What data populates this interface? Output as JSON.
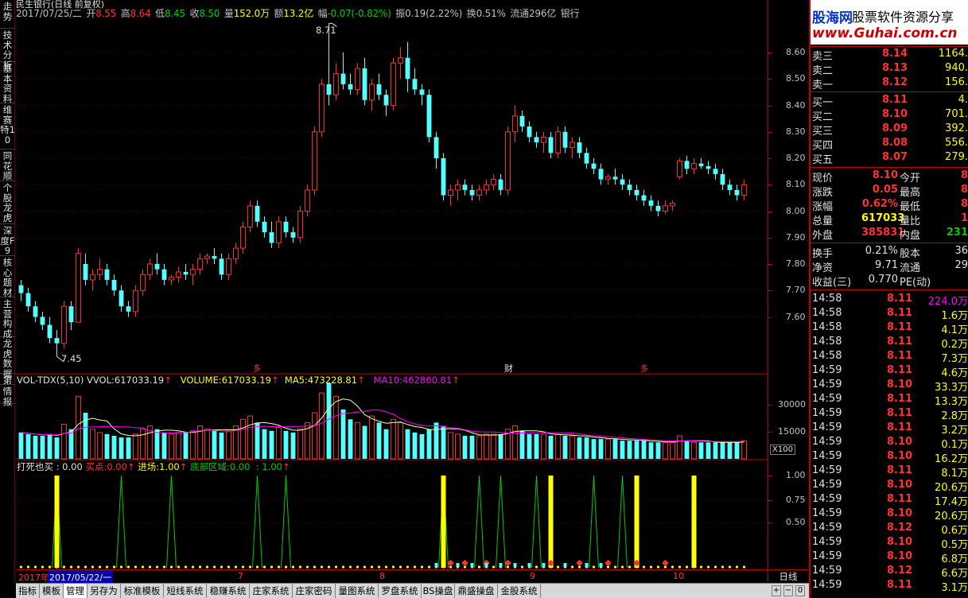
{
  "window": {
    "title": "民生银行(日线 前复权)"
  },
  "info_bar": {
    "date": "2017/07/25/二",
    "open_label": "开",
    "open": "8.55",
    "high_label": "高",
    "high": "8.64",
    "low_label": "低",
    "low": "8.45",
    "close_label": "收",
    "close": "8.50",
    "volume_label": "量",
    "volume": "152.0万",
    "amount_label": "额",
    "amount": "13.2亿",
    "change_label": "幅",
    "change": "-0.07(-0.82%)",
    "amplitude_label": "振",
    "amplitude": "0.19(2.22%)",
    "turnover_label": "换",
    "turnover": "0.51%",
    "float_label": "流通",
    "float": "296亿",
    "industry": "银行"
  },
  "side_tabs": [
    "走势",
    "技术分析",
    "基本资料",
    "维赛特10",
    "同花顺",
    "个股龙虎",
    "深度F9",
    "核心题材",
    "主营构成",
    "龙虎数据",
    "第",
    "情报"
  ],
  "main_chart_annotations": {
    "high_label": "8.71",
    "low_label": "7.45",
    "event_markers": [
      "多",
      "财",
      "多"
    ]
  },
  "price_axis": [
    "8.60",
    "8.50",
    "8.40",
    "8.30",
    "8.20",
    "8.10",
    "8.00",
    "7.90",
    "7.80",
    "7.70",
    "7.60"
  ],
  "volume_panel": {
    "title": "VOL-TDX(5,10)",
    "vvol_label": "VVOL:",
    "vvol": "617033.19",
    "volume_label": "VOLUME:",
    "volume": "617033.19",
    "ma5_label": "MA5:",
    "ma5": "473228.81",
    "ma10_label": "MA10:",
    "ma10": "462860.81",
    "axis": [
      "30000",
      "15000"
    ],
    "unit": "X100"
  },
  "indicator_panel": {
    "name": "打死也买",
    "value": ": 0.00",
    "buy_label": "买点:",
    "buy": "0.00",
    "enter_label": "进场:",
    "enter": "1.00",
    "bottom_label": "底部区域:",
    "bottom": "0.00",
    "extra": ": 1.00",
    "axis": [
      "1.00",
      "0.75",
      "0.50"
    ]
  },
  "date_axis": {
    "start": "2017年",
    "cursor": "2017/05/22/一",
    "months": [
      "7",
      "8",
      "9",
      "10"
    ],
    "period_label": "日线"
  },
  "bottom_tabs": [
    "指标",
    "模板",
    "管理",
    "另存为",
    "标准模板",
    "短线系统",
    "稳赚系统",
    "庄家系统",
    "庄家密码",
    "量图系统",
    "罗盘系统",
    "BS操盘",
    "鼎盛操盘",
    "金股系统"
  ],
  "bottom_tabs_active": "管理",
  "logo": {
    "site_name": "股海网",
    "tagline": "股票软件资源分享",
    "url": "www.Guhai.com.cn"
  },
  "order_book": {
    "asks": [
      {
        "label": "卖三",
        "price": "8.14",
        "vol": "1164."
      },
      {
        "label": "卖二",
        "price": "8.13",
        "vol": "940."
      },
      {
        "label": "卖一",
        "price": "8.12",
        "vol": "156."
      }
    ],
    "bids": [
      {
        "label": "买一",
        "price": "8.11",
        "vol": "4."
      },
      {
        "label": "买二",
        "price": "8.10",
        "vol": "701."
      },
      {
        "label": "买三",
        "price": "8.09",
        "vol": "392."
      },
      {
        "label": "买四",
        "price": "8.08",
        "vol": "556."
      },
      {
        "label": "买五",
        "price": "8.07",
        "vol": "279."
      }
    ]
  },
  "quote": {
    "rows": [
      {
        "l1": "现价",
        "v1": "8.10",
        "l2": "今开",
        "v2": "8"
      },
      {
        "l1": "涨跌",
        "v1": "0.05",
        "l2": "最高",
        "v2": "8"
      },
      {
        "l1": "涨幅",
        "v1": "0.62%",
        "l2": "最低",
        "v2": "8"
      },
      {
        "l1": "总量",
        "v1": "617033",
        "l2": "量比",
        "v2": "1"
      },
      {
        "l1": "外盘",
        "v1": "385831",
        "l2": "内盘",
        "v2": "231"
      }
    ],
    "rows2": [
      {
        "l1": "换手",
        "v1": "0.21%",
        "l2": "股本",
        "v2": "36"
      },
      {
        "l1": "净资",
        "v1": "9.71",
        "l2": "流通",
        "v2": "29"
      },
      {
        "l1": "收益(三)",
        "v1": "0.770",
        "l2": "PE(动)",
        "v2": ""
      }
    ]
  },
  "ticks": [
    {
      "time": "14:58",
      "price": "8.11",
      "vol": "224.0万"
    },
    {
      "time": "14:58",
      "price": "8.11",
      "vol": "1.6万"
    },
    {
      "time": "14:58",
      "price": "8.11",
      "vol": "4.1万"
    },
    {
      "time": "14:58",
      "price": "8.11",
      "vol": "0.2万"
    },
    {
      "time": "14:58",
      "price": "8.11",
      "vol": "7.3万"
    },
    {
      "time": "14:59",
      "price": "8.11",
      "vol": "4.6万"
    },
    {
      "time": "14:59",
      "price": "8.10",
      "vol": "33.3万"
    },
    {
      "time": "14:59",
      "price": "8.11",
      "vol": "13.3万"
    },
    {
      "time": "14:59",
      "price": "8.11",
      "vol": "2.8万"
    },
    {
      "time": "14:59",
      "price": "8.11",
      "vol": "3.2万"
    },
    {
      "time": "14:59",
      "price": "8.10",
      "vol": "0.1万"
    },
    {
      "time": "14:59",
      "price": "8.10",
      "vol": "16.2万"
    },
    {
      "time": "14:59",
      "price": "8.11",
      "vol": "8.1万"
    },
    {
      "time": "14:59",
      "price": "8.10",
      "vol": "20.6万"
    },
    {
      "time": "14:59",
      "price": "8.11",
      "vol": "17.4万"
    },
    {
      "time": "14:59",
      "price": "8.10",
      "vol": "20.6万"
    },
    {
      "time": "14:59",
      "price": "8.12",
      "vol": "0.6万"
    },
    {
      "time": "14:59",
      "price": "8.10",
      "vol": "0.5万"
    },
    {
      "time": "14:59",
      "price": "8.10",
      "vol": "6.8万"
    },
    {
      "time": "14:59",
      "price": "8.12",
      "vol": "6.6万"
    },
    {
      "time": "14:59",
      "price": "8.11",
      "vol": "3.1万"
    }
  ],
  "colors": {
    "up": "#ff3232",
    "down": "#54ffff",
    "border": "#c00000",
    "yellow": "#ffff00",
    "green": "#00cc00",
    "magenta": "#ff00ff",
    "white": "#ffffff"
  },
  "chart_data": {
    "type": "candlestick",
    "ylim": [
      7.45,
      8.71
    ],
    "candles": [
      [
        7.72,
        7.74,
        7.66,
        7.69
      ],
      [
        7.69,
        7.71,
        7.62,
        7.64
      ],
      [
        7.64,
        7.66,
        7.58,
        7.6
      ],
      [
        7.6,
        7.62,
        7.55,
        7.57
      ],
      [
        7.57,
        7.6,
        7.5,
        7.52
      ],
      [
        7.52,
        7.55,
        7.45,
        7.5
      ],
      [
        7.5,
        7.66,
        7.48,
        7.64
      ],
      [
        7.64,
        7.66,
        7.55,
        7.58
      ],
      [
        7.58,
        7.86,
        7.58,
        7.84
      ],
      [
        7.8,
        7.84,
        7.72,
        7.74
      ],
      [
        7.74,
        7.78,
        7.7,
        7.76
      ],
      [
        7.76,
        7.82,
        7.74,
        7.78
      ],
      [
        7.78,
        7.8,
        7.72,
        7.74
      ],
      [
        7.74,
        7.76,
        7.68,
        7.7
      ],
      [
        7.7,
        7.72,
        7.62,
        7.64
      ],
      [
        7.64,
        7.66,
        7.6,
        7.62
      ],
      [
        7.62,
        7.72,
        7.6,
        7.7
      ],
      [
        7.7,
        7.78,
        7.68,
        7.76
      ],
      [
        7.76,
        7.82,
        7.74,
        7.8
      ],
      [
        7.8,
        7.84,
        7.76,
        7.78
      ],
      [
        7.78,
        7.8,
        7.72,
        7.74
      ],
      [
        7.74,
        7.76,
        7.72,
        7.75
      ],
      [
        7.75,
        7.79,
        7.73,
        7.77
      ],
      [
        7.77,
        7.8,
        7.74,
        7.76
      ],
      [
        7.76,
        7.8,
        7.72,
        7.78
      ],
      [
        7.78,
        7.84,
        7.76,
        7.82
      ],
      [
        7.82,
        7.84,
        7.8,
        7.83
      ],
      [
        7.83,
        7.86,
        7.8,
        7.82
      ],
      [
        7.82,
        7.84,
        7.74,
        7.76
      ],
      [
        7.76,
        7.84,
        7.74,
        7.82
      ],
      [
        7.82,
        7.88,
        7.8,
        7.86
      ],
      [
        7.86,
        7.96,
        7.84,
        7.94
      ],
      [
        7.94,
        8.04,
        7.92,
        8.02
      ],
      [
        8.02,
        8.04,
        7.94,
        7.96
      ],
      [
        7.96,
        7.98,
        7.9,
        7.92
      ],
      [
        7.92,
        7.96,
        7.86,
        7.88
      ],
      [
        7.88,
        7.98,
        7.86,
        7.96
      ],
      [
        7.96,
        7.98,
        7.9,
        7.92
      ],
      [
        7.92,
        7.94,
        7.88,
        7.9
      ],
      [
        7.9,
        8.02,
        7.88,
        8.0
      ],
      [
        8.0,
        8.1,
        7.98,
        8.08
      ],
      [
        8.08,
        8.32,
        8.06,
        8.3
      ],
      [
        8.3,
        8.5,
        8.28,
        8.48
      ],
      [
        8.48,
        8.71,
        8.4,
        8.44
      ],
      [
        8.44,
        8.56,
        8.42,
        8.52
      ],
      [
        8.52,
        8.6,
        8.46,
        8.48
      ],
      [
        8.48,
        8.52,
        8.44,
        8.46
      ],
      [
        8.46,
        8.56,
        8.44,
        8.54
      ],
      [
        8.54,
        8.58,
        8.4,
        8.42
      ],
      [
        8.42,
        8.5,
        8.38,
        8.48
      ],
      [
        8.48,
        8.52,
        8.42,
        8.44
      ],
      [
        8.44,
        8.46,
        8.36,
        8.4
      ],
      [
        8.4,
        8.58,
        8.38,
        8.56
      ],
      [
        8.56,
        8.62,
        8.5,
        8.58
      ],
      [
        8.58,
        8.64,
        8.45,
        8.5
      ],
      [
        8.5,
        8.54,
        8.44,
        8.46
      ],
      [
        8.46,
        8.48,
        8.4,
        8.44
      ],
      [
        8.44,
        8.46,
        8.26,
        8.28
      ],
      [
        8.28,
        8.3,
        8.16,
        8.2
      ],
      [
        8.2,
        8.22,
        8.04,
        8.06
      ],
      [
        8.06,
        8.1,
        8.02,
        8.08
      ],
      [
        8.08,
        8.12,
        8.04,
        8.1
      ],
      [
        8.1,
        8.12,
        8.06,
        8.08
      ],
      [
        8.08,
        8.1,
        8.04,
        8.06
      ],
      [
        8.06,
        8.1,
        8.04,
        8.08
      ],
      [
        8.08,
        8.12,
        8.06,
        8.1
      ],
      [
        8.1,
        8.14,
        8.08,
        8.12
      ],
      [
        8.12,
        8.14,
        8.06,
        8.08
      ],
      [
        8.08,
        8.32,
        8.06,
        8.3
      ],
      [
        8.3,
        8.4,
        8.26,
        8.36
      ],
      [
        8.36,
        8.38,
        8.3,
        8.32
      ],
      [
        8.32,
        8.34,
        8.26,
        8.28
      ],
      [
        8.28,
        8.3,
        8.24,
        8.26
      ],
      [
        8.26,
        8.3,
        8.22,
        8.28
      ],
      [
        8.28,
        8.3,
        8.2,
        8.22
      ],
      [
        8.22,
        8.32,
        8.2,
        8.3
      ],
      [
        8.3,
        8.32,
        8.22,
        8.24
      ],
      [
        8.24,
        8.28,
        8.2,
        8.26
      ],
      [
        8.26,
        8.28,
        8.2,
        8.22
      ],
      [
        8.22,
        8.24,
        8.16,
        8.18
      ],
      [
        8.18,
        8.2,
        8.14,
        8.16
      ],
      [
        8.16,
        8.18,
        8.1,
        8.12
      ],
      [
        8.12,
        8.14,
        8.1,
        8.13
      ],
      [
        8.13,
        8.16,
        8.1,
        8.12
      ],
      [
        8.12,
        8.14,
        8.08,
        8.1
      ],
      [
        8.1,
        8.12,
        8.06,
        8.08
      ],
      [
        8.08,
        8.1,
        8.04,
        8.06
      ],
      [
        8.06,
        8.08,
        8.02,
        8.04
      ],
      [
        8.04,
        8.06,
        8.0,
        8.02
      ],
      [
        8.02,
        8.04,
        7.98,
        8.0
      ],
      [
        8.0,
        8.04,
        7.99,
        8.02
      ],
      [
        8.02,
        8.04,
        8.0,
        8.03
      ],
      [
        8.13,
        8.2,
        8.12,
        8.19
      ],
      [
        8.19,
        8.21,
        8.14,
        8.16
      ],
      [
        8.16,
        8.2,
        8.14,
        8.18
      ],
      [
        8.18,
        8.2,
        8.16,
        8.17
      ],
      [
        8.17,
        8.19,
        8.14,
        8.16
      ],
      [
        8.16,
        8.18,
        8.12,
        8.14
      ],
      [
        8.14,
        8.16,
        8.08,
        8.1
      ],
      [
        8.1,
        8.12,
        8.06,
        8.08
      ],
      [
        8.08,
        8.1,
        8.04,
        8.06
      ],
      [
        8.06,
        8.12,
        8.04,
        8.1
      ]
    ],
    "volume": [
      16,
      15,
      14,
      14,
      15,
      13,
      21,
      18,
      38,
      28,
      18,
      16,
      15,
      14,
      13,
      13,
      15,
      18,
      20,
      18,
      16,
      15,
      16,
      16,
      17,
      20,
      18,
      17,
      16,
      17,
      20,
      24,
      26,
      22,
      18,
      17,
      19,
      17,
      16,
      18,
      22,
      28,
      40,
      46,
      38,
      30,
      24,
      22,
      20,
      26,
      22,
      18,
      24,
      22,
      18,
      16,
      15,
      18,
      22,
      20,
      16,
      15,
      14,
      14,
      14,
      15,
      15,
      15,
      18,
      20,
      17,
      15,
      15,
      15,
      14,
      15,
      14,
      14,
      13,
      13,
      12,
      12,
      12,
      12,
      11,
      11,
      11,
      11,
      10,
      10,
      10,
      10,
      14,
      11,
      10,
      10,
      10,
      10,
      10,
      10,
      10,
      11
    ],
    "vol_ylim": [
      0,
      42000
    ]
  }
}
